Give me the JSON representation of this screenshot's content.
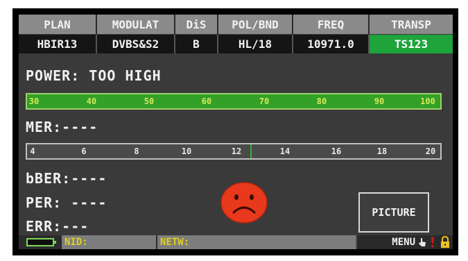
{
  "header": {
    "columns": [
      {
        "label": "PLAN",
        "value": "HBIR13"
      },
      {
        "label": "MODULAT",
        "value": "DVBS&S2"
      },
      {
        "label": "DiS",
        "value": "B"
      },
      {
        "label": "POL/BND",
        "value": "HL/18"
      },
      {
        "label": "FREQ",
        "value": "10971.0"
      },
      {
        "label": "TRANSP",
        "value": "TS123"
      }
    ]
  },
  "power": {
    "label": "POWER:",
    "status": "TOO HIGH",
    "scale": [
      "30",
      "40",
      "50",
      "60",
      "70",
      "80",
      "90",
      "100"
    ]
  },
  "mer": {
    "label": "MER:",
    "value": "----",
    "scale": [
      "4",
      "6",
      "8",
      "10",
      "12",
      "14",
      "16",
      "18",
      "20"
    ]
  },
  "bber": {
    "label": "bBER:",
    "value": "----"
  },
  "per": {
    "label": "PER:",
    "value": "----"
  },
  "err": {
    "label": "ERR:",
    "value": "---"
  },
  "picture_button": "PICTURE",
  "footer": {
    "nid_label": "NID:",
    "netw_label": "NETW:",
    "menu_label": "MENU"
  },
  "colors": {
    "active_header": "#1fa33b",
    "power_bar": "#33a028",
    "sad_face": "#e8391c",
    "warning": "#d01818",
    "lock": "#f0c020"
  },
  "icons": [
    "battery-icon",
    "sad-face-icon",
    "hand-pointer-icon",
    "alert-icon",
    "lock-icon"
  ]
}
